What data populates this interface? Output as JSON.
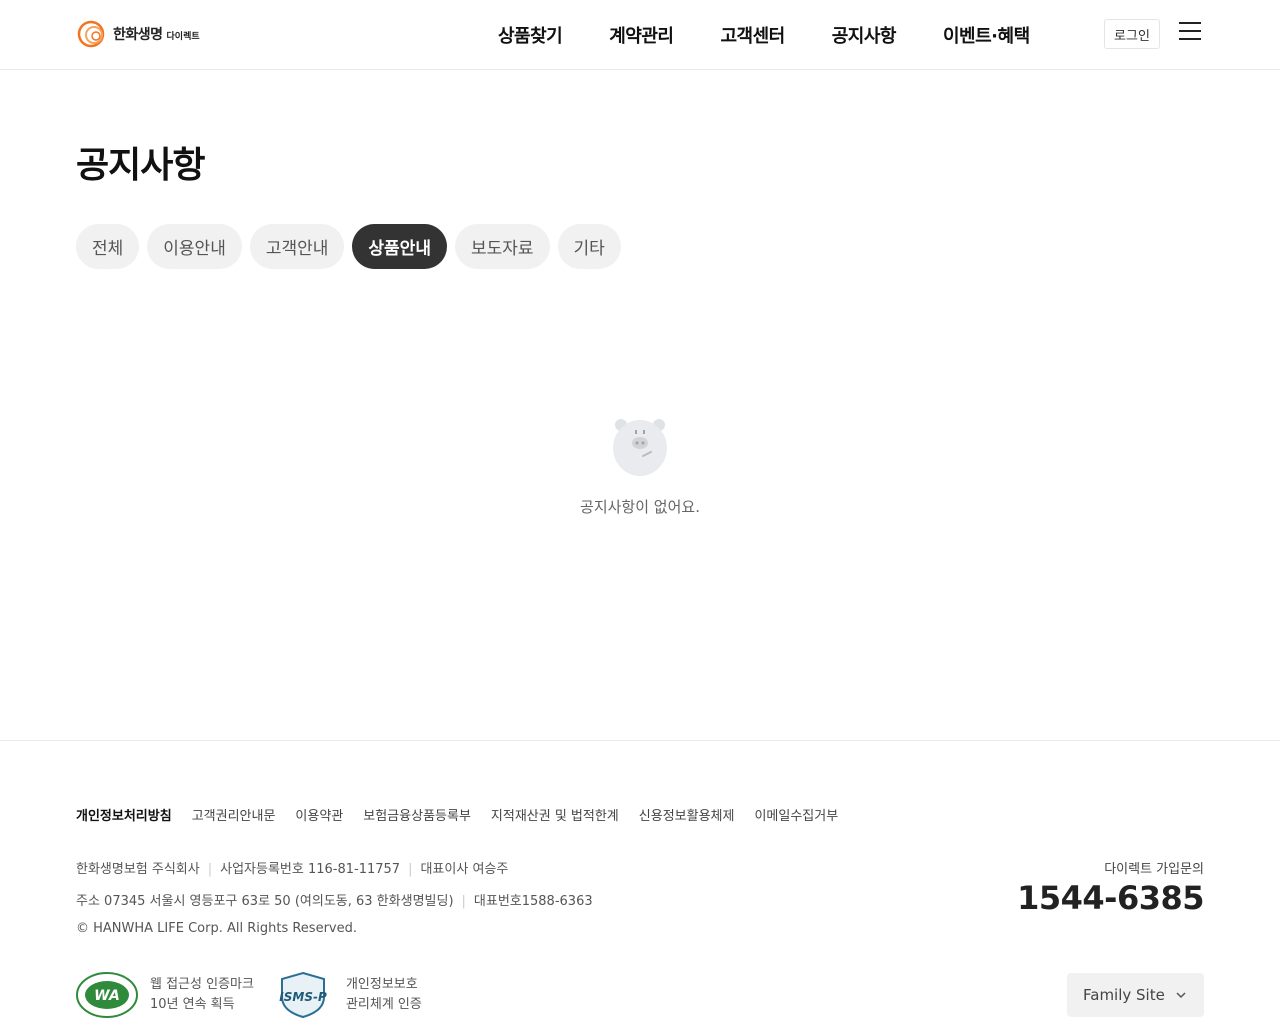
{
  "header": {
    "logo_text": "한화생명",
    "logo_sub": "다이렉트",
    "nav": [
      "상품찾기",
      "계약관리",
      "고객센터",
      "공지사항",
      "이벤트·혜택"
    ],
    "login_label": "로그인",
    "menu_icon": "hamburger-icon"
  },
  "main": {
    "title": "공지사항",
    "tabs": [
      {
        "label": "전체",
        "active": false
      },
      {
        "label": "이용안내",
        "active": false
      },
      {
        "label": "고객안내",
        "active": false
      },
      {
        "label": "상품안내",
        "active": true
      },
      {
        "label": "보도자료",
        "active": false
      },
      {
        "label": "기타",
        "active": false
      }
    ],
    "empty_icon": "piggy-bank-icon",
    "empty_message": "공지사항이 없어요."
  },
  "footer": {
    "links": [
      "개인정보처리방침",
      "고객권리안내문",
      "이용약관",
      "보험금융상품등록부",
      "지적재산권 및 법적한계",
      "신용정보활용체제",
      "이메일수집거부"
    ],
    "company": "한화생명보험 주식회사",
    "business_no": "사업자등록번호 116-81-11757",
    "ceo": "대표이사 여승주",
    "address": "주소 07345 서울시 영등포구 63로 50 (여의도동, 63 한화생명빌딩)",
    "main_phone": "대표번호1588-6363",
    "copyright": "© HANWHA LIFE Corp. All Rights Reserved.",
    "contact_label": "다이렉트 가입문의",
    "contact_phone": "1544-6385",
    "cert1": {
      "line1": "웹 접근성 인증마크",
      "line2": "10년 연속 획득",
      "badge_text": "WA"
    },
    "cert2": {
      "line1": "개인정보보호",
      "line2": "관리체계 인증",
      "badge_text": "ISMS-P"
    },
    "family_site": "Family Site"
  },
  "colors": {
    "brand_orange": "#f37321",
    "active_tab": "#333333",
    "tab_bg": "#f1f1f1"
  }
}
